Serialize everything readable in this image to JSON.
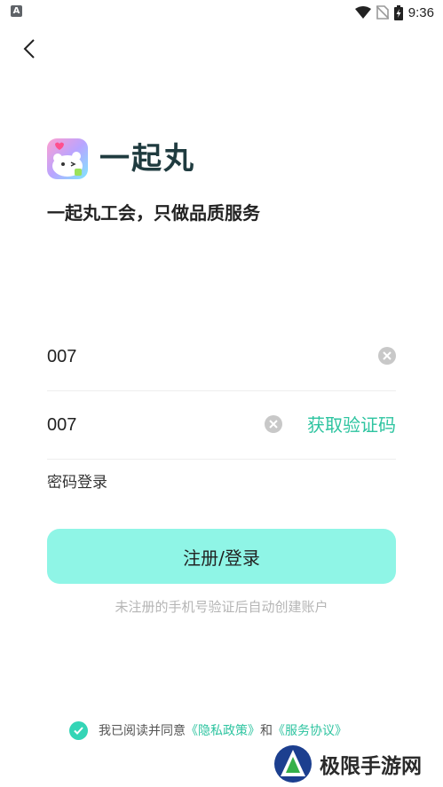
{
  "status_bar": {
    "time": "9:36"
  },
  "header": {
    "back_icon": "chevron-left-icon"
  },
  "brand": {
    "name": "一起丸",
    "slogan": "一起丸工会，只做品质服务"
  },
  "form": {
    "phone_value": "007",
    "code_value": "007",
    "get_code_label": "获取验证码",
    "password_login_label": "密码登录",
    "submit_label": "注册/登录",
    "hint": "未注册的手机号验证后自动创建账户"
  },
  "agreement": {
    "prefix": "我已阅读并同意",
    "privacy_label": "《隐私政策》",
    "conjunction": "和",
    "terms_label": "《服务协议》"
  },
  "watermark": {
    "text": "极限手游网"
  },
  "colors": {
    "accent": "#2ec4a0",
    "button_bg": "#8ff5e6",
    "check": "#34d5b6"
  }
}
